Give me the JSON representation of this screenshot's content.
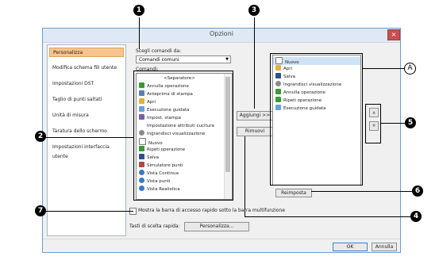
{
  "dialog": {
    "title": "Opzioni",
    "close_glyph": "×"
  },
  "sidebar": {
    "items": [
      {
        "label": "Personalizza",
        "selected": true
      },
      {
        "label": "Modifica schema fili utente"
      },
      {
        "label": "Impostazioni DST"
      },
      {
        "label": "Taglio di punti saltati"
      },
      {
        "label": "Unità di misura"
      },
      {
        "label": "Taratura dello schermo"
      },
      {
        "label": "Impostazioni interfaccia utente"
      }
    ]
  },
  "commands": {
    "choose_label": "Scegli comandi da:",
    "choose_value": "Comandi comuni",
    "list_label": "Comandi:",
    "items": [
      {
        "label": "<Separatore>",
        "icon": "none"
      },
      {
        "label": "Annulla operazione",
        "icon": "undo-icon"
      },
      {
        "label": "Anteprima di stampa",
        "icon": "print-preview-icon"
      },
      {
        "label": "Apri",
        "icon": "folder-icon"
      },
      {
        "label": "Esecuzione guidata",
        "icon": "wizard-icon"
      },
      {
        "label": "Impost. stampa",
        "icon": "print-setup-icon"
      },
      {
        "label": "Impostazione attributi cucitura",
        "icon": "none"
      },
      {
        "label": "Ingrandisci visualizzazione",
        "icon": "zoom-icon"
      },
      {
        "label": "Nuovo",
        "icon": "new-doc-icon"
      },
      {
        "label": "Ripeti operazione",
        "icon": "redo-icon"
      },
      {
        "label": "Salva",
        "icon": "save-icon"
      },
      {
        "label": "Simulatore punti",
        "icon": "simulator-icon"
      },
      {
        "label": "Vista Continua",
        "icon": "view-icon"
      },
      {
        "label": "Vista punti",
        "icon": "view-icon"
      },
      {
        "label": "Vista Realistica",
        "icon": "view-icon"
      }
    ]
  },
  "buttons": {
    "add": "Aggiungi >>",
    "remove": "Rimuovi",
    "reset": "Reimposta",
    "customize": "Personalizza...",
    "ok": "OK",
    "cancel": "Annulla",
    "up_glyph": "▲",
    "down_glyph": "▼"
  },
  "quick_access": {
    "items": [
      {
        "label": "Nuovo",
        "icon": "new-doc-icon"
      },
      {
        "label": "Apri",
        "icon": "folder-icon"
      },
      {
        "label": "Salva",
        "icon": "save-icon"
      },
      {
        "label": "Ingrandisci visualizzazione",
        "icon": "zoom-icon"
      },
      {
        "label": "Annulla operazione",
        "icon": "undo-icon"
      },
      {
        "label": "Ripeti operazione",
        "icon": "redo-icon"
      },
      {
        "label": "Esecuzione guidata",
        "icon": "wizard-icon"
      }
    ]
  },
  "checkbox": {
    "label": "Mostra la barra di accesso rapido sotto la barra multifunzione",
    "checked": false
  },
  "shortcuts_label": "Tasti di scelta rapida:",
  "callouts": {
    "c1": "1",
    "c2": "2",
    "c3": "3",
    "c4": "4",
    "c5": "5",
    "c6": "6",
    "c7": "7",
    "cA": "A"
  }
}
